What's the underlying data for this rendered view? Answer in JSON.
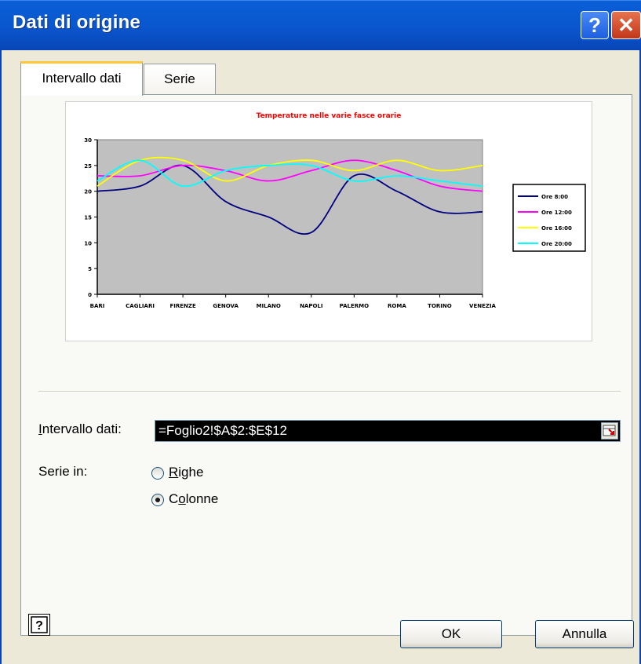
{
  "window": {
    "title": "Dati di origine",
    "help_glyph": "?",
    "close_glyph": "✕"
  },
  "tabs": [
    {
      "label": "Intervallo dati",
      "active": true
    },
    {
      "label": "Serie",
      "active": false
    }
  ],
  "range": {
    "label_first": "I",
    "label_rest": "ntervallo dati:",
    "value": "=Foglio2!$A$2:$E$12"
  },
  "series_in": {
    "label": "Serie in:",
    "options": [
      {
        "accel": "R",
        "rest": "ighe",
        "selected": false
      },
      {
        "prefix": "C",
        "accel": "o",
        "rest": "lonne",
        "selected": true
      }
    ]
  },
  "buttons": {
    "ok": "OK",
    "cancel": "Annulla"
  },
  "chart_data": {
    "type": "line",
    "title": "Temperature nelle varie fasce orarie",
    "categories": [
      "BARI",
      "CAGLIARI",
      "FIRENZE",
      "GENOVA",
      "MILANO",
      "NAPOLI",
      "PALERMO",
      "ROMA",
      "TORINO",
      "VENEZIA"
    ],
    "ylim": [
      0,
      30
    ],
    "yticks": [
      0,
      5,
      10,
      15,
      20,
      25,
      30
    ],
    "grid": false,
    "plot_background": "#c0c0c0",
    "legend_position": "right",
    "series": [
      {
        "name": "Ore 8:00",
        "color": "#000080",
        "values": [
          20,
          21,
          25,
          18,
          15,
          12,
          23,
          20,
          16,
          16
        ]
      },
      {
        "name": "Ore 12:00",
        "color": "#ff00ff",
        "values": [
          23,
          23,
          25,
          24,
          22,
          24,
          26,
          24,
          21,
          20
        ]
      },
      {
        "name": "Ore 16:00",
        "color": "#ffff00",
        "values": [
          21,
          26,
          26,
          22,
          25,
          26,
          24,
          26,
          24,
          25
        ]
      },
      {
        "name": "Ore 20:00",
        "color": "#00ffff",
        "values": [
          22,
          26,
          21,
          24,
          25,
          25,
          22,
          23,
          22,
          21
        ]
      }
    ]
  }
}
